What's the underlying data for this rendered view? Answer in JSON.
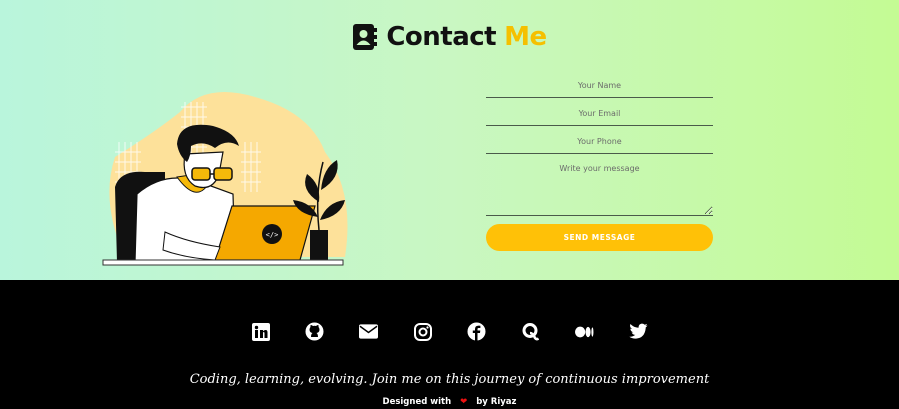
{
  "header": {
    "title_main": "Contact",
    "title_accent": "Me",
    "icon": "contact-book-icon"
  },
  "form": {
    "name_placeholder": "Your Name",
    "email_placeholder": "Your Email",
    "phone_placeholder": "Your Phone",
    "message_placeholder": "Write your message",
    "submit_label": "SEND MESSAGE"
  },
  "footer": {
    "social_icons": [
      "linkedin-icon",
      "github-icon",
      "email-icon",
      "instagram-icon",
      "facebook-icon",
      "quora-icon",
      "medium-icon",
      "twitter-icon"
    ],
    "tagline": "Coding, learning, evolving. Join me on this journey of continuous improvement",
    "credit_prefix": "Designed with",
    "credit_suffix": "by Riyaz"
  },
  "colors": {
    "accent": "#ffc107",
    "title_accent": "#f5c000",
    "footer_bg": "#000000",
    "heart": "#e11111"
  }
}
